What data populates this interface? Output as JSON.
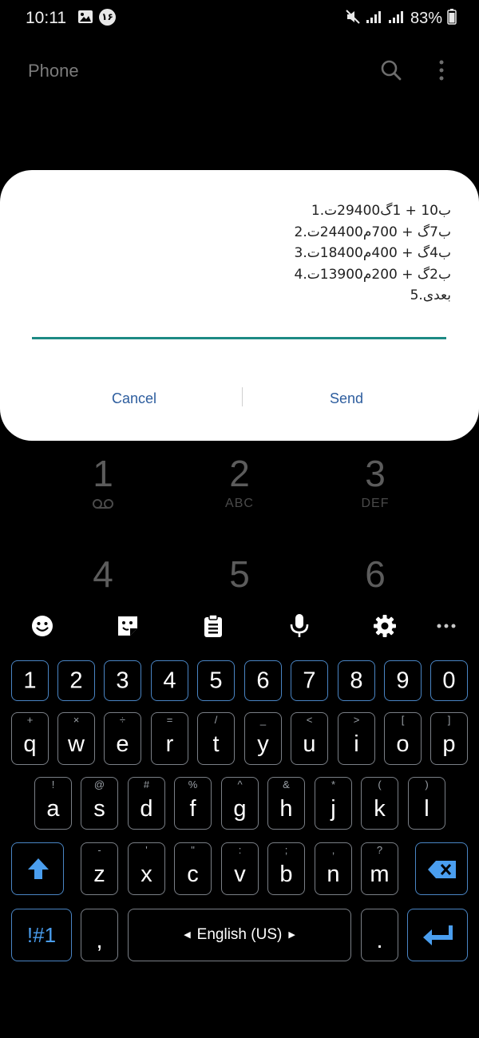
{
  "status": {
    "time": "10:11",
    "notif_badge": "۱۶",
    "battery": "83%"
  },
  "app": {
    "title": "Phone"
  },
  "dialpad": {
    "keys": [
      {
        "digit": "1",
        "letters": ""
      },
      {
        "digit": "2",
        "letters": "ABC"
      },
      {
        "digit": "3",
        "letters": "DEF"
      },
      {
        "digit": "4",
        "letters": ""
      },
      {
        "digit": "5",
        "letters": ""
      },
      {
        "digit": "6",
        "letters": ""
      }
    ]
  },
  "dialog": {
    "lines": [
      "1.ب10 + 1گ29400ت",
      "2.ب7گ + 700م24400ت",
      "3.ب4گ + 400م18400ت",
      "4.ب2گ + 200م13900ت",
      "5.بعدی"
    ],
    "input_value": "",
    "cancel_label": "Cancel",
    "send_label": "Send"
  },
  "keyboard": {
    "toolbar": [
      "emoji-icon",
      "sticker-icon",
      "clipboard-icon",
      "microphone-icon",
      "gear-icon",
      "more-icon"
    ],
    "number_row": [
      "1",
      "2",
      "3",
      "4",
      "5",
      "6",
      "7",
      "8",
      "9",
      "0"
    ],
    "row1": {
      "keys": [
        "q",
        "w",
        "e",
        "r",
        "t",
        "y",
        "u",
        "i",
        "o",
        "p"
      ],
      "hints": [
        "+",
        "×",
        "÷",
        "=",
        "/",
        "_",
        "<",
        ">",
        "[",
        "]"
      ]
    },
    "row2": {
      "keys": [
        "a",
        "s",
        "d",
        "f",
        "g",
        "h",
        "j",
        "k",
        "l"
      ],
      "hints": [
        "!",
        "@",
        "#",
        "%",
        "^",
        "&",
        "*",
        "(",
        ")"
      ]
    },
    "row3": {
      "keys": [
        "z",
        "x",
        "c",
        "v",
        "b",
        "n",
        "m"
      ],
      "hints": [
        "-",
        "'",
        "\"",
        ":",
        ";",
        ",",
        "?"
      ]
    },
    "symbols_label": "!#1",
    "comma_label": ",",
    "space_label": "English (US)",
    "period_label": ".",
    "accent_color": "#4a9eef"
  }
}
